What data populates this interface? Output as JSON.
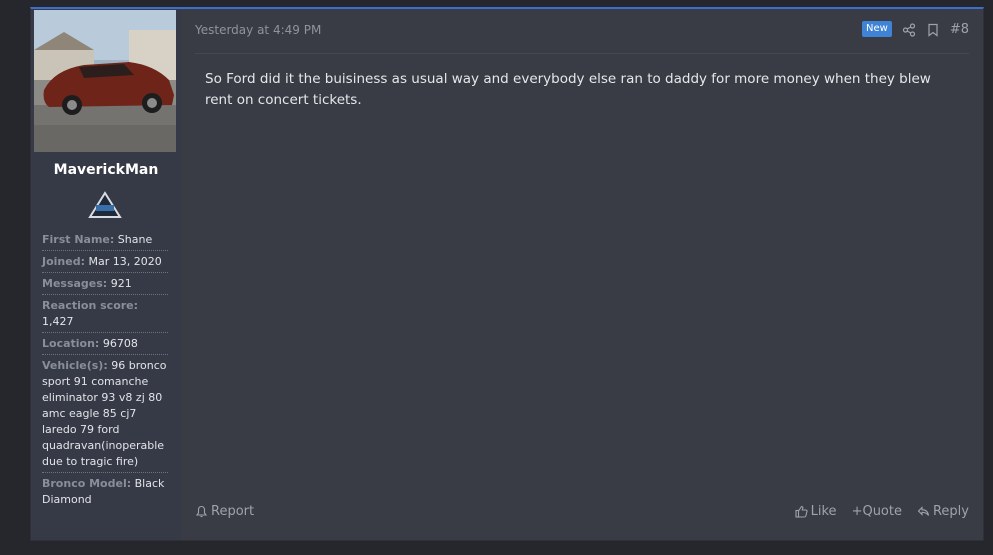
{
  "user": {
    "username": "MaverickMan",
    "fields": [
      {
        "label": "First Name:",
        "value": "Shane"
      },
      {
        "label": "Joined:",
        "value": "Mar 13, 2020"
      },
      {
        "label": "Messages:",
        "value": "921"
      },
      {
        "label": "Reaction score:",
        "value": "1,427"
      },
      {
        "label": "Location:",
        "value": "96708"
      },
      {
        "label": "Vehicle(s):",
        "value": "96 bronco sport 91 comanche eliminator 93 v8 zj 80 amc eagle 85 cj7 laredo 79 ford quadravan(inoperable due to tragic fire)"
      },
      {
        "label": "Bronco Model:",
        "value": "Black Diamond"
      }
    ]
  },
  "post": {
    "timestamp": "Yesterday at 4:49 PM",
    "new_badge": "New",
    "number": "#8",
    "message": "So Ford did it the buisiness as usual way and everybody else ran to daddy for more money when they blew rent on concert tickets."
  },
  "footer": {
    "report": "Report",
    "like": "Like",
    "quote": "+Quote",
    "reply": "Reply"
  },
  "icons": {
    "share": "share-icon",
    "bookmark": "bookmark-icon",
    "flag": "flag-icon",
    "like": "thumbs-up-icon",
    "reply": "reply-icon"
  },
  "colors": {
    "accent": "#3f83d6",
    "panel": "#393c45",
    "user_panel": "#363a47"
  }
}
